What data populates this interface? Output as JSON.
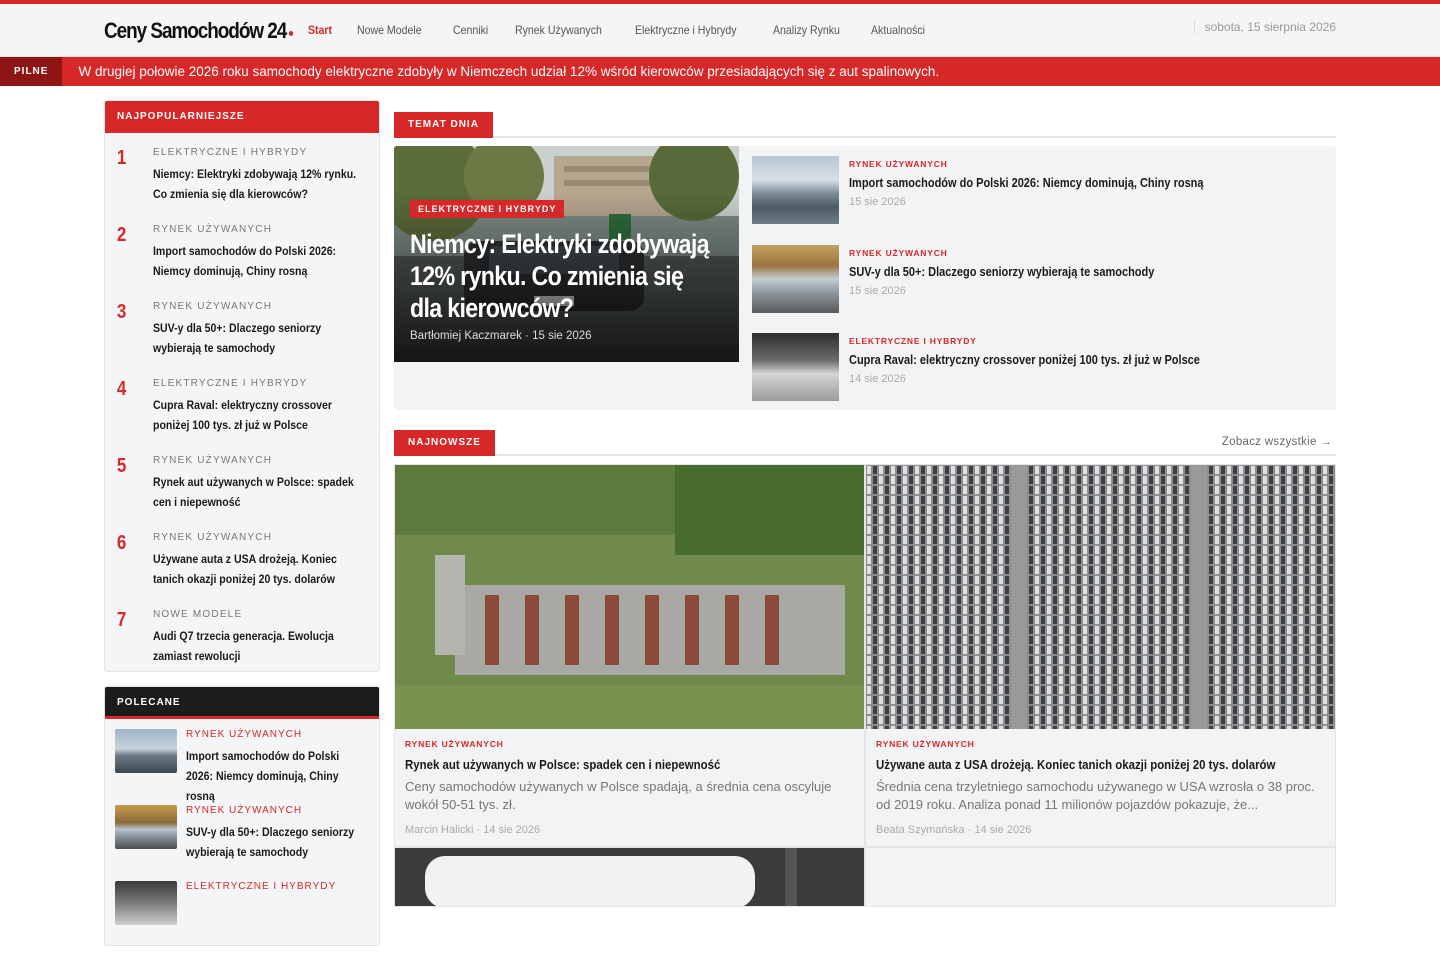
{
  "header": {
    "logo": "Ceny Samochodów 24",
    "nav": [
      "Start",
      "Nowe Modele",
      "Cenniki",
      "Rynek Używanych",
      "Elektryczne i Hybrydy",
      "Analizy Rynku",
      "Aktualności"
    ],
    "active_nav": "Start",
    "date": "sobota, 15 sierpnia 2026"
  },
  "breaking": {
    "label": "PILNE",
    "text": "W drugiej połowie 2026 roku samochody elektryczne zdobyły w Niemczech udział 12% wśród kierowców przesiadających się z aut spalinowych."
  },
  "popular": {
    "heading": "NAJPOPULARNIEJSZE",
    "items": [
      {
        "num": "1",
        "category": "ELEKTRYCZNE I HYBRYDY",
        "title": "Niemcy: Elektryki zdobywają 12% rynku. Co zmienia się dla kierowców?"
      },
      {
        "num": "2",
        "category": "RYNEK UŻYWANYCH",
        "title": "Import samochodów do Polski 2026: Niemcy dominują, Chiny rosną"
      },
      {
        "num": "3",
        "category": "RYNEK UŻYWANYCH",
        "title": "SUV-y dla 50+: Dlaczego seniorzy wybierają te samochody"
      },
      {
        "num": "4",
        "category": "ELEKTRYCZNE I HYBRYDY",
        "title": "Cupra Raval: elektryczny crossover poniżej 100 tys. zł już w Polsce"
      },
      {
        "num": "5",
        "category": "RYNEK UŻYWANYCH",
        "title": "Rynek aut używanych w Polsce: spadek cen i niepewność"
      },
      {
        "num": "6",
        "category": "RYNEK UŻYWANYCH",
        "title": "Używane auta z USA drożeją. Koniec tanich okazji poniżej 20 tys. dolarów"
      },
      {
        "num": "7",
        "category": "NOWE MODELE",
        "title": "Audi Q7 trzecia generacja. Ewolucja zamiast rewolucji"
      }
    ]
  },
  "recommended": {
    "heading": "POLECANE",
    "items": [
      {
        "category": "RYNEK UŻYWANYCH",
        "title": "Import samochodów do Polski 2026: Niemcy dominują, Chiny rosną"
      },
      {
        "category": "RYNEK UŻYWANYCH",
        "title": "SUV-y dla 50+: Dlaczego seniorzy wybierają te samochody"
      },
      {
        "category": "ELEKTRYCZNE I HYBRYDY",
        "title": ""
      }
    ]
  },
  "topic": {
    "heading": "TEMAT DNIA",
    "hero": {
      "category": "ELEKTRYCZNE I HYBRYDY",
      "title": "Niemcy: Elektryki zdobywają 12% rynku. Co zmienia się dla kierowców?",
      "author": "Bartłomiej Kaczmarek",
      "date": "15 sie 2026"
    },
    "side": [
      {
        "category": "RYNEK UŻYWANYCH",
        "title": "Import samochodów do Polski 2026: Niemcy dominują, Chiny rosną",
        "date": "15 sie 2026"
      },
      {
        "category": "RYNEK UŻYWANYCH",
        "title": "SUV-y dla 50+: Dlaczego seniorzy wybierają te samochody",
        "date": "15 sie 2026"
      },
      {
        "category": "ELEKTRYCZNE I HYBRYDY",
        "title": "Cupra Raval: elektryczny crossover poniżej 100 tys. zł już w Polsce",
        "date": "14 sie 2026"
      }
    ]
  },
  "latest": {
    "heading": "NAJNOWSZE",
    "see_all": "Zobacz wszystkie →",
    "cards": [
      {
        "category": "RYNEK UŻYWANYCH",
        "title": "Rynek aut używanych w Polsce: spadek cen i niepewność",
        "excerpt": "Ceny samochodów używanych w Polsce spadają, a średnia cena oscyluje wokół 50-51 tys. zł.",
        "author": "Marcin Halicki",
        "date": "14 sie 2026"
      },
      {
        "category": "RYNEK UŻYWANYCH",
        "title": "Używane auta z USA drożeją. Koniec tanich okazji poniżej 20 tys. dolarów",
        "excerpt": "Średnia cena trzyletniego samochodu używanego w USA wzrosła o 38 proc. od 2019 roku. Analiza ponad 11 milionów pojazdów pokazuje, że...",
        "author": "Beata Szymańska",
        "date": "14 sie 2026"
      }
    ]
  },
  "colors": {
    "accent": "#d62828",
    "dark": "#1c1c1c",
    "background": "#f4f5f6"
  }
}
